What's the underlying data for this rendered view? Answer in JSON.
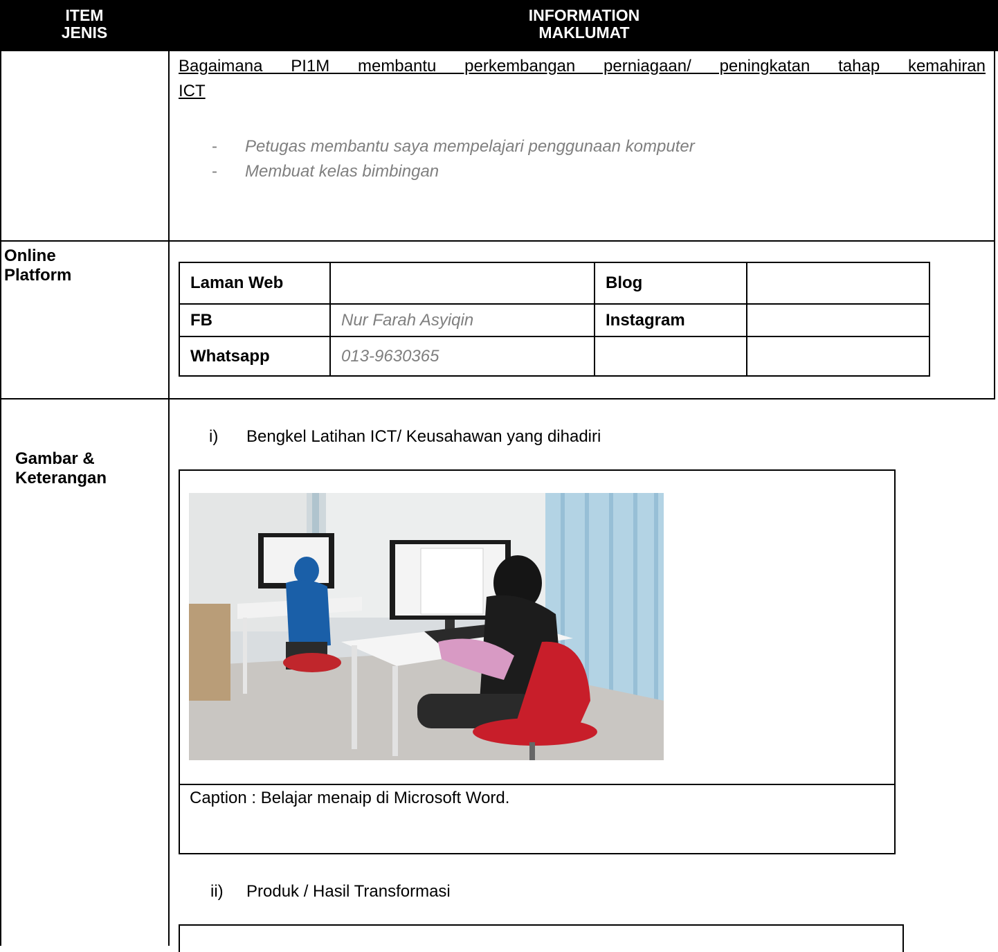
{
  "header": {
    "item_en": "ITEM",
    "item_ms": "JENIS",
    "info_en": "INFORMATION",
    "info_ms": "MAKLUMAT"
  },
  "section1": {
    "heading_line1": "Bagaimana PI1M membantu perkembangan perniagaan/ peningkatan tahap kemahiran",
    "heading_line2": "ICT",
    "bullets": [
      "Petugas membantu saya mempelajari penggunaan komputer",
      "Membuat kelas bimbingan"
    ],
    "bullet_mark": "-"
  },
  "online": {
    "label_line1": "Online",
    "label_line2": "Platform",
    "rows": [
      {
        "k1": "Laman Web",
        "v1": "",
        "k2": "Blog",
        "v2": ""
      },
      {
        "k1": "FB",
        "v1": "Nur Farah Asyiqin",
        "k2": "Instagram",
        "v2": ""
      },
      {
        "k1": "Whatsapp",
        "v1": "013-9630365",
        "k2": "",
        "v2": ""
      }
    ]
  },
  "gambar": {
    "label_line1": "Gambar &",
    "label_line2": "Keterangan",
    "item1_num": "i)",
    "item1_text": "Bengkel Latihan ICT/ Keusahawan yang dihadiri",
    "caption": "Caption : Belajar menaip di  Microsoft Word.",
    "item2_num": "ii)",
    "item2_text": "Produk / Hasil Transformasi"
  }
}
